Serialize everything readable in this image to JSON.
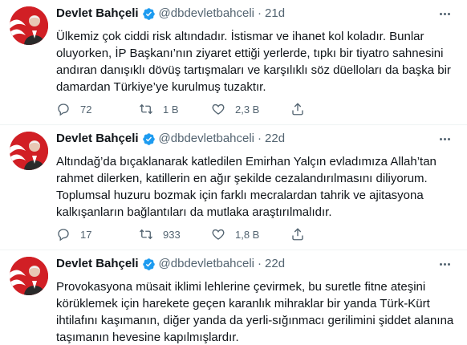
{
  "tweets": [
    {
      "name": "Devlet Bahçeli",
      "handle": "@dbdevletbahceli",
      "separator": "·",
      "time": "21d",
      "text": "Ülkemiz çok ciddi risk altındadır. İstismar ve ihanet kol koladır. Bunlar oluyorken, İP Başkanı’nın ziyaret ettiği yerlerde, tıpkı bir tiyatro sahnesini andıran danışıklı dövüş tartışmaları ve karşılıklı söz düelloları da başka bir damardan Türkiye’ye kurulmuş tuzaktır.",
      "replies": "72",
      "retweets": "1 B",
      "likes": "2,3 B"
    },
    {
      "name": "Devlet Bahçeli",
      "handle": "@dbdevletbahceli",
      "separator": "·",
      "time": "22d",
      "text": "Altındağ’da bıçaklanarak katledilen Emirhan Yalçın evladımıza Allah’tan rahmet dilerken, katillerin en ağır şekilde cezalandırılmasını diliyorum. Toplumsal huzuru bozmak için farklı mecralardan tahrik ve ajitasyona kalkışanların bağlantıları da mutlaka araştırılmalıdır.",
      "replies": "17",
      "retweets": "933",
      "likes": "1,8 B"
    },
    {
      "name": "Devlet Bahçeli",
      "handle": "@dbdevletbahceli",
      "separator": "·",
      "time": "22d",
      "text": "Provokasyona müsait iklimi lehlerine çevirmek, bu suretle fitne ateşini körüklemek için harekete geçen karanlık mihraklar bir yanda Türk-Kürt ihtilafını kaşımanın, diğer yanda da yerli-sığınmacı gerilimini şiddet alanına taşımanın hevesine kapılmışlardır."
    }
  ],
  "colors": {
    "verified": "#1d9bf0",
    "secondary_text": "#536471",
    "divider": "#eff3f4",
    "avatar_bg": "#d11f25"
  },
  "icons": [
    "verified-badge-icon",
    "more-icon",
    "reply-icon",
    "retweet-icon",
    "like-icon",
    "share-icon"
  ]
}
